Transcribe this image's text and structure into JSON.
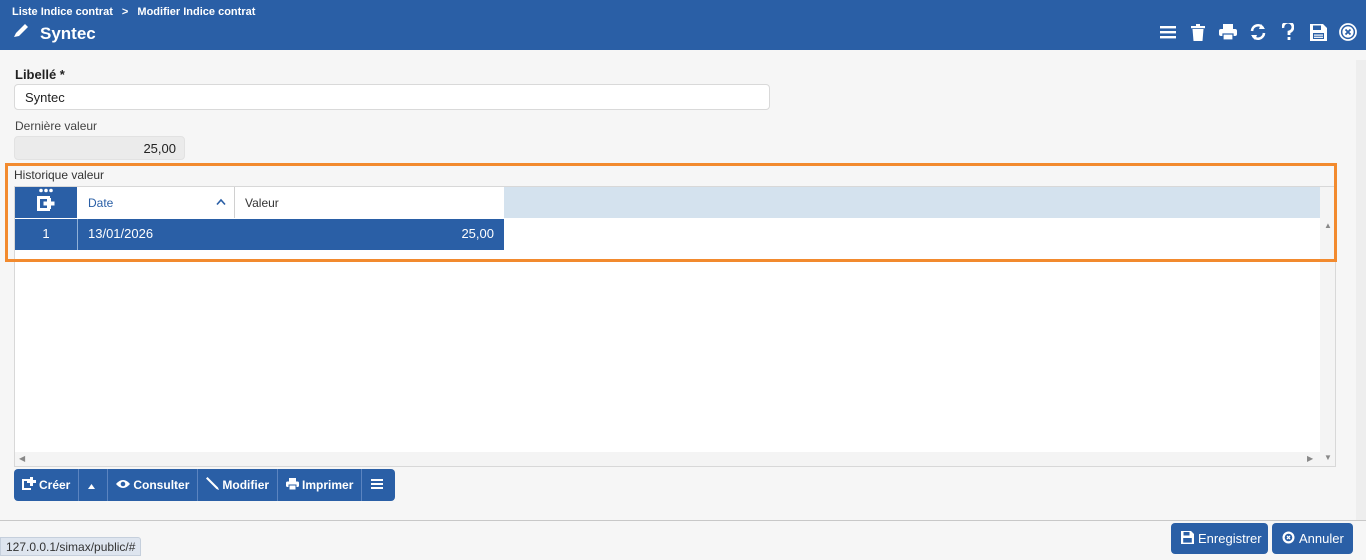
{
  "header": {
    "breadcrumb": [
      "Liste Indice contrat",
      ">",
      "Modifier Indice contrat"
    ],
    "title": "Syntec",
    "toolbar_icons": [
      "menu-icon",
      "trash-icon",
      "print-icon",
      "refresh-icon",
      "help-icon",
      "save-icon",
      "close-circle-icon"
    ]
  },
  "form": {
    "libelle_label": "Libellé *",
    "libelle_value": "Syntec",
    "derniere_label": "Dernière valeur",
    "derniere_value": "25,00"
  },
  "historique": {
    "label": "Historique valeur",
    "columns": [
      "Date",
      "Valeur"
    ],
    "rows": [
      {
        "num": "1",
        "date": "13/01/2026",
        "valeur": "25,00"
      }
    ]
  },
  "actions": {
    "creer": "Créer",
    "consulter": "Consulter",
    "modifier": "Modifier",
    "imprimer": "Imprimer"
  },
  "footer": {
    "status_url": "127.0.0.1/simax/public/#",
    "enregistrer": "Enregistrer",
    "annuler": "Annuler"
  },
  "colors": {
    "primary": "#2a5fa6",
    "highlight": "#f28a2e",
    "grid_header": "#d4e2ee"
  }
}
